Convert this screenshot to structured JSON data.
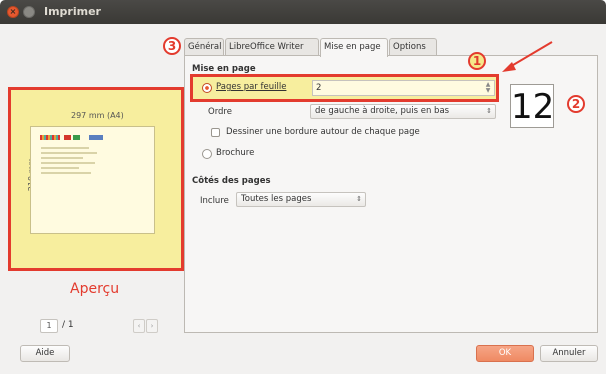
{
  "window": {
    "title": "Imprimer"
  },
  "tabs": [
    "Général",
    "LibreOffice Writer",
    "Mise en page",
    "Options"
  ],
  "active_tab": "Mise en page",
  "layout": {
    "section_title": "Mise en page",
    "pages_per_sheet_label": "Pages par feuille",
    "pages_per_sheet_value": "2",
    "order_label": "Ordre",
    "order_value": "de gauche à droite, puis en bas",
    "border_checkbox_label": "Dessiner une bordure autour de chaque page",
    "brochure_label": "Brochure"
  },
  "sides": {
    "section_title": "Côtés des pages",
    "include_label": "Inclure",
    "include_value": "Toutes les pages"
  },
  "preview": {
    "paper_width": "297 mm (A4)",
    "paper_height": "210 mm",
    "caption": "Aperçu",
    "page_current": "1",
    "page_total": "/ 1"
  },
  "callouts": {
    "one": "1",
    "two": "2",
    "three": "3",
    "big_value": "12"
  },
  "buttons": {
    "help": "Aide",
    "ok": "OK",
    "cancel": "Annuler"
  },
  "colors": {
    "annotation_red": "#e33b2e",
    "highlight_yellow": "#f7ee9e",
    "ok_orange": "#ef8a63"
  }
}
